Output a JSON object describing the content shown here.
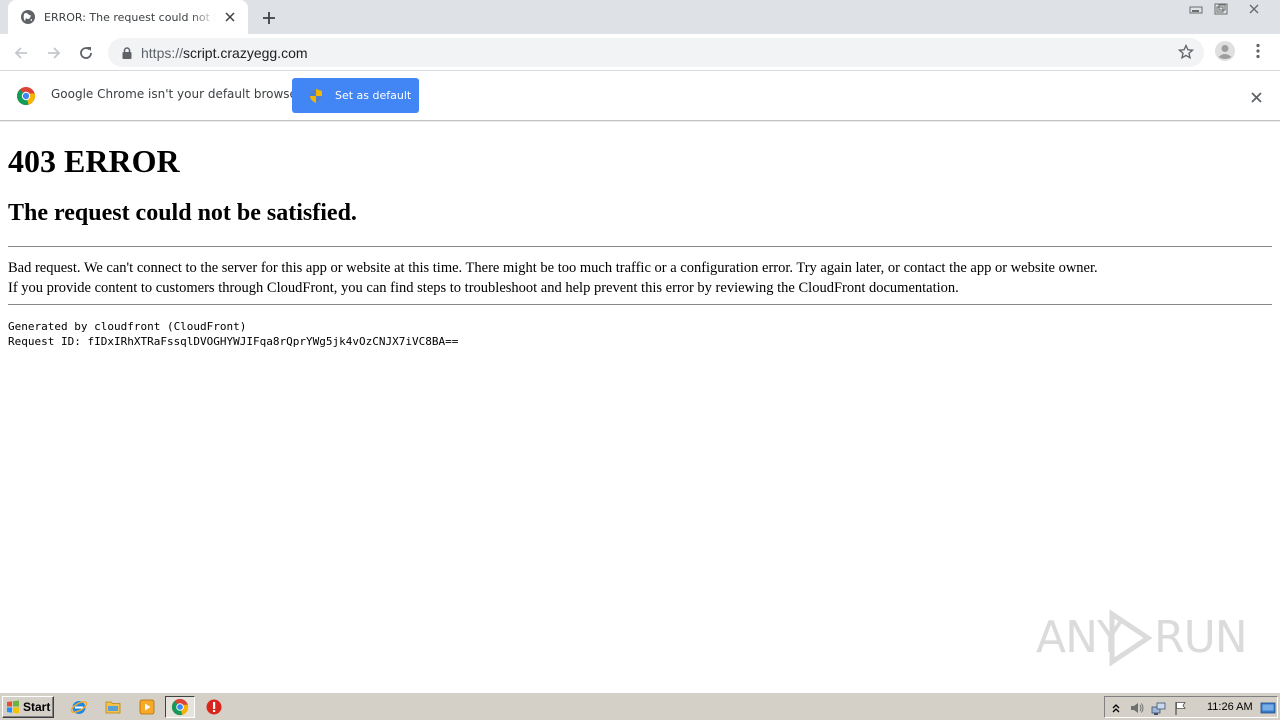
{
  "browser": {
    "tab": {
      "title": "ERROR: The request could not be satisfied"
    },
    "address_bar": {
      "scheme": "https://",
      "host": "script.crazyegg.com"
    }
  },
  "infobar": {
    "message": "Google Chrome isn't your default browser",
    "button_label": "Set as default"
  },
  "page": {
    "heading": "403 ERROR",
    "subheading": "The request could not be satisfied.",
    "paragraph_line1": "Bad request. We can't connect to the server for this app or website at this time. There might be too much traffic or a configuration error. Try again later, or contact the app or website owner.",
    "paragraph_line2": "If you provide content to customers through CloudFront, you can find steps to troubleshoot and help prevent this error by reviewing the CloudFront documentation.",
    "generated_by": "Generated by cloudfront (CloudFront)",
    "request_id": "Request ID: fIDxIRhXTRaFssqlDVOGHYWJIFqa8rQprYWg5jk4vOzCNJX7iVC8BA=="
  },
  "watermark": {
    "left": "ANY",
    "right": "RUN"
  },
  "taskbar": {
    "start_label": "Start",
    "clock": "11:26 AM"
  },
  "colors": {
    "accent_blue": "#4285f4",
    "tabstrip": "#dee1e6",
    "taskbar": "#d4d0c8"
  },
  "icons": [
    "globe-icon",
    "close-icon",
    "plus-icon",
    "minimize-icon",
    "restore-icon",
    "window-close-icon",
    "back-arrow-icon",
    "forward-arrow-icon",
    "reload-icon",
    "lock-icon",
    "star-icon",
    "profile-icon",
    "kebab-menu-icon",
    "chrome-logo-icon",
    "uac-shield-icon",
    "windows-logo-icon",
    "ie-icon",
    "folder-icon",
    "media-player-icon",
    "chrome-icon",
    "stop-icon",
    "tray-expand-icon",
    "volume-icon",
    "network-icon",
    "flag-icon",
    "show-desktop-icon"
  ]
}
